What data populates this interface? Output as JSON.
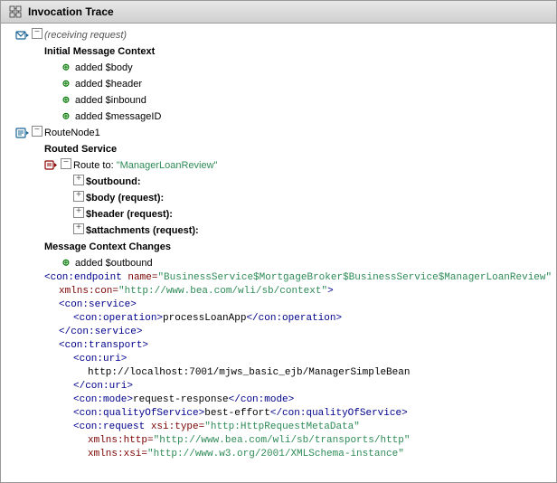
{
  "window": {
    "title": "Invocation Trace"
  },
  "tree": {
    "root": {
      "label": "(receiving request)",
      "children": [
        {
          "type": "section-header",
          "label": "Initial Message Context",
          "children": [
            {
              "label": "added $body"
            },
            {
              "label": "added $header"
            },
            {
              "label": "added $inbound"
            },
            {
              "label": "added $messageID"
            }
          ]
        },
        {
          "type": "route-node",
          "label": "RouteNode1",
          "section": "Routed Service",
          "routeTo": "\"ManagerLoanReview\"",
          "outbound": "$outbound:",
          "body": "$body (request):",
          "header": "$header (request):",
          "attachments": "$attachments (request):",
          "msgContextChanges": "Message Context Changes",
          "addedOutbound": "added $outbound",
          "xmlLines": [
            "<con:endpoint name=\"BusinessService$MortgageBroker$BusinessService$ManagerLoanReview\"",
            "    xmlns:con=\"http://www.bea.com/wli/sb/context\">",
            "    <con:service>",
            "        <con:operation>processLoanApp</con:operation>",
            "    </con:service>",
            "    <con:transport>",
            "        <con:uri>",
            "            http://localhost:7001/mjws_basic_ejb/ManagerSimpleBean",
            "        </con:uri>",
            "        <con:mode>request-response</con:mode>",
            "        <con:qualityOfService>best-effort</con:qualityOfService>",
            "        <con:request xsi:type=\"http:HttpRequestMetaData\"",
            "            xmlns:http=\"http://www.bea.com/wli/sb/transports/http\"",
            "            xmlns:xsi=\"http://www.w3.org/2001/XMLSchema-instance\""
          ]
        }
      ]
    }
  }
}
